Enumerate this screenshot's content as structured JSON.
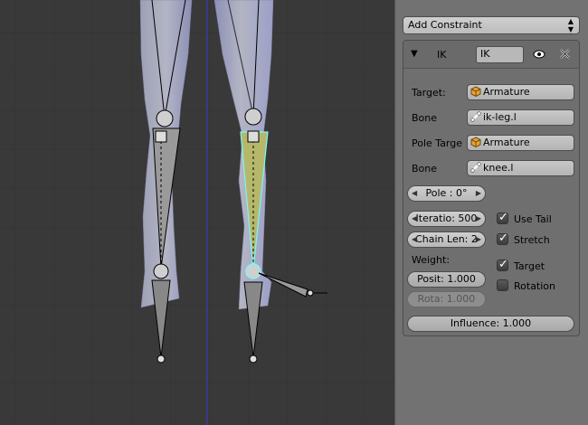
{
  "add_constraint": {
    "label": "Add Constraint"
  },
  "constraint": {
    "type_label": "IK",
    "name_value": "IK",
    "target_label": "Target:",
    "target_value": "Armature",
    "bone_label": "Bone",
    "bone_value": "ik-leg.l",
    "pole_target_label": "Pole Targe",
    "pole_target_value": "Armature",
    "pole_bone_label": "Bone",
    "pole_bone_value": "knee.l",
    "pole_angle": "Pole : 0°",
    "iterations": "Iteratio: 500",
    "chain_length": "Chain Len: 2",
    "use_tail_label": "Use Tail",
    "use_tail": true,
    "stretch_label": "Stretch",
    "stretch": true,
    "weight_label": "Weight:",
    "position_weight": "Posit: 1.000",
    "rotation_weight": "Rota: 1.000",
    "target_check_label": "Target",
    "target_check": true,
    "rotation_check_label": "Rotation",
    "rotation_check": false,
    "influence": "Influence: 1.000"
  },
  "colors": {
    "selected_bone": "#b5b86a",
    "bone_outline_selected": "#7ff5f5",
    "panel_bg": "#727272",
    "viewport_bg": "#393939"
  },
  "icons": [
    "mesh-object-icon",
    "bone-icon",
    "eye-icon",
    "close-icon",
    "disclosure-triangle-icon",
    "dropdown-arrows-icon"
  ]
}
